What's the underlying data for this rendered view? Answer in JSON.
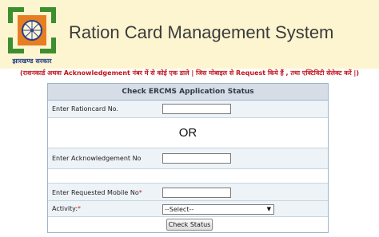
{
  "header": {
    "title": "Ration Card Management System",
    "logo_caption": "झारखण्ड सरकार"
  },
  "notice": "(राशनकार्ड अथवा Acknowledgement नंबर में से कोई एक डाले | जिस मोबाइल से Request किये हैं , तथा एक्टिविटी सेलेक्ट करें |)",
  "form": {
    "title": "Check ERCMS Application Status",
    "rationcard_label": "Enter Rationcard No.",
    "or_text": "OR",
    "ack_label": "Enter Acknowledgement No",
    "mobile_label": "Enter Requested Mobile No",
    "activity_label": "Activity:",
    "required_mark": "*",
    "activity_selected": "--Select--",
    "submit_label": "Check Status"
  },
  "colors": {
    "header_bg": "#fdf5d0",
    "logo_green": "#3e8e2f",
    "logo_orange": "#e67e22",
    "logo_blue": "#2a3f8f",
    "notice_red": "#c0141e"
  }
}
